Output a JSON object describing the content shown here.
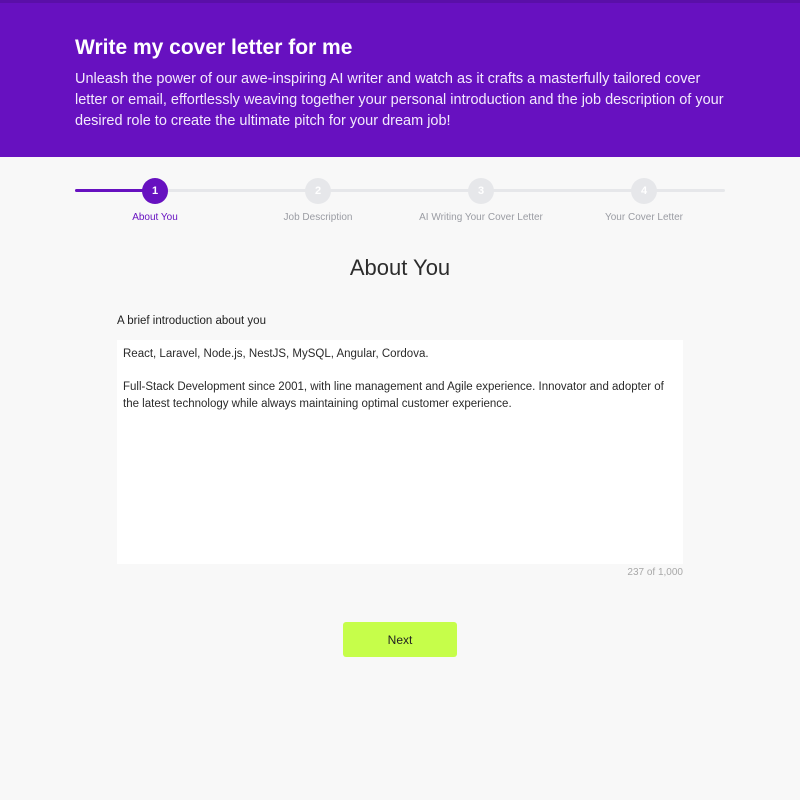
{
  "header": {
    "title": "Write my cover letter for me",
    "description": "Unleash the power of our awe-inspiring AI writer and watch as it crafts a masterfully tailored cover letter or email, effortlessly weaving together your personal introduction and the job description of your desired role to create the ultimate pitch for your dream job!"
  },
  "stepper": {
    "steps": [
      {
        "number": "1",
        "label": "About You",
        "active": true
      },
      {
        "number": "2",
        "label": "Job Description",
        "active": false
      },
      {
        "number": "3",
        "label": "AI Writing Your Cover Letter",
        "active": false
      },
      {
        "number": "4",
        "label": "Your Cover Letter",
        "active": false
      }
    ]
  },
  "main": {
    "section_title": "About You",
    "intro_label": "A brief introduction about you",
    "intro_value": "React, Laravel, Node.js, NestJS, MySQL, Angular, Cordova.\n\nFull-Stack Development since 2001, with line management and Agile experience. Innovator and adopter of the latest technology while always maintaining optimal customer experience.",
    "char_count": "237 of 1,000",
    "next_label": "Next"
  },
  "colors": {
    "brand_purple": "#6711c0",
    "accent_lime": "#c6fe4a",
    "inactive_grey": "#e6e7ea"
  }
}
